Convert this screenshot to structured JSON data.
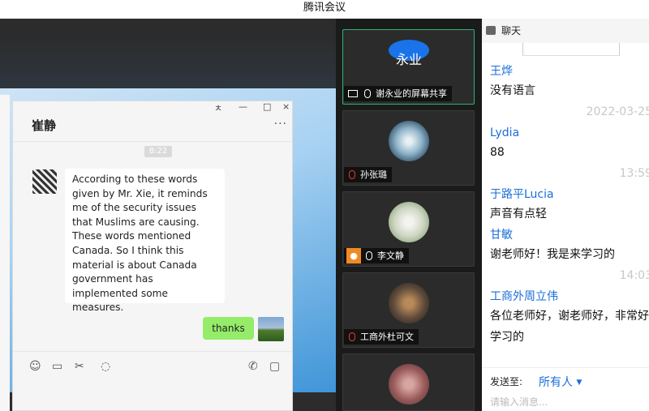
{
  "window": {
    "title": "腾讯会议"
  },
  "shared_screen": {
    "chat_window": {
      "controls": [
        "ㅊ",
        "—",
        "□",
        "×"
      ],
      "contact_name": "崔静",
      "more": "···",
      "time": "8:22",
      "incoming_message": "According to these words given by Mr. Xie, it reminds me of the security issues that Muslims are causing. These words mentioned Canada. So I think this material is about Canada government has implemented some measures.",
      "outgoing_message": "thanks",
      "toolbar_icons": [
        "emoji-icon",
        "folder-icon",
        "scissors-icon",
        "chat-bubble-icon",
        "phone-icon",
        "video-icon"
      ]
    }
  },
  "participants": [
    {
      "name": "谢永业的屏幕共享",
      "avatar_text": "永业",
      "active": true
    },
    {
      "name": "孙张璐"
    },
    {
      "name": "李文静"
    },
    {
      "name": "工商外杜可文"
    },
    {
      "name": ""
    }
  ],
  "chat_panel": {
    "title": "聊天",
    "messages": [
      {
        "sender": "王烨",
        "text": "没有语言"
      },
      {
        "timestamp": "2022-03-25"
      },
      {
        "sender": "Lydia",
        "text": "88"
      },
      {
        "timestamp": "13:59"
      },
      {
        "sender": "于路平Lucia",
        "text": "声音有点轻"
      },
      {
        "sender": "甘敏",
        "text": "谢老师好！我是来学习的"
      },
      {
        "timestamp": "14:03"
      },
      {
        "sender": "工商外周立伟",
        "text": "各位老师好，谢老师好，非常好",
        "text2": "学习的"
      }
    ],
    "send_to_label": "发送至:",
    "recipient": "所有人",
    "dropdown_arrow": "▼",
    "input_placeholder": "请输入消息..."
  }
}
